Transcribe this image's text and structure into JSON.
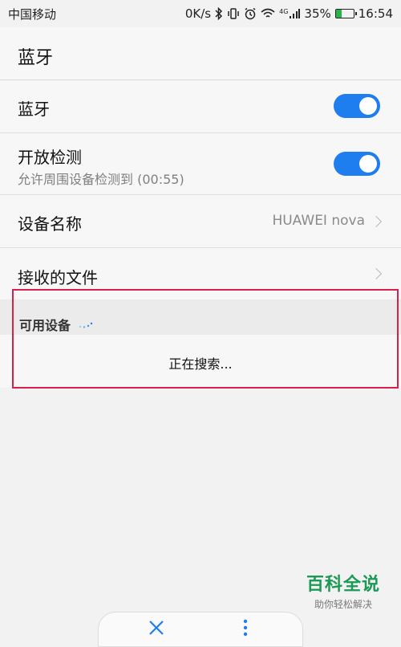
{
  "status_bar": {
    "carrier": "中国移动",
    "net_speed": "0K/s",
    "network_type": "4G",
    "battery_percent": "35%",
    "battery_level": 0.35,
    "time": "16:54",
    "icons": [
      "bluetooth-icon",
      "vibrate-icon",
      "alarm-icon",
      "wifi-icon",
      "signal-icon",
      "battery-icon"
    ]
  },
  "header": {
    "title": "蓝牙"
  },
  "rows": {
    "bluetooth": {
      "label": "蓝牙",
      "on": true
    },
    "discoverable": {
      "label": "开放检测",
      "sub": "允许周围设备检测到 (00:55)",
      "on": true
    },
    "device_name": {
      "label": "设备名称",
      "value": "HUAWEI nova"
    },
    "received_files": {
      "label": "接收的文件"
    }
  },
  "available": {
    "title": "可用设备",
    "searching": "正在搜索..."
  },
  "watermark": {
    "title": "百科全说",
    "subtitle": "助你轻松解决"
  },
  "colors": {
    "accent": "#1e7ef0",
    "highlight": "#d9204a",
    "watermark": "#1a9a55"
  }
}
